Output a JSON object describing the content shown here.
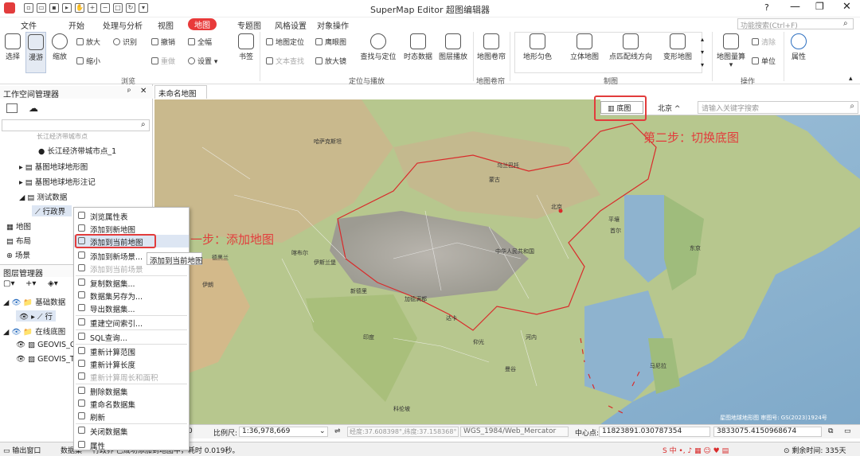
{
  "app": {
    "title": "SuperMap Editor 超图编辑器",
    "search_placeholder": "功能搜索(Ctrl+F)"
  },
  "menu": {
    "tabs": [
      "文件",
      "开始",
      "处理与分析",
      "视图",
      "地图",
      "专题图",
      "风格设置",
      "对象操作"
    ],
    "active": "地图"
  },
  "ribbon": {
    "select": "选择",
    "pan": "漫游",
    "zoom": "缩放",
    "zoom_in": "放大",
    "identify": "识别",
    "zoom_out": "缩小",
    "undo": "撤销",
    "full": "全幅",
    "redo": "重做",
    "settings": "设置",
    "bookmark": "书签",
    "browse_group": "浏览",
    "map_locate": "地图定位",
    "eagle": "鹰眼图",
    "text_find": "文本查找",
    "magnifier": "放大镜",
    "find_locate": "查找与定位",
    "dynamic_data": "时态数据",
    "layer_play": "图层播放",
    "locate_group": "定位与播放",
    "map_roller": "地图卷帘",
    "roller_group": "地图卷帘",
    "terrain_color": "地形匀色",
    "stereo": "立体地图",
    "point_direction": "点匹配线方向",
    "deform": "变形地图",
    "draw_group": "制图",
    "measure": "地图量算",
    "clear": "清除",
    "unit": "单位",
    "ops_group": "操作",
    "properties": "属性"
  },
  "workspace": {
    "title": "工作空间管理器",
    "items": [
      "长江经济带城市点",
      "长江经济带城市点_1",
      "基图地球地形图",
      "基图地球地形注记",
      "测试数据",
      "行政界",
      "地图",
      "布局",
      "场景"
    ]
  },
  "layers": {
    "title": "图层管理器",
    "items": [
      "基础数据",
      "行",
      "在线底图",
      "GEOVIS_C",
      "GEOVIS_T"
    ]
  },
  "context_menu": {
    "items": [
      {
        "label": "浏览属性表",
        "disabled": false
      },
      {
        "label": "添加到新地图",
        "disabled": false
      },
      {
        "label": "添加到当前地图",
        "disabled": false
      },
      {
        "label": "添加到新场景...",
        "disabled": false
      },
      {
        "label": "添加到当前场景",
        "disabled": true
      },
      {
        "label": "复制数据集...",
        "disabled": false
      },
      {
        "label": "数据集另存为...",
        "disabled": false
      },
      {
        "label": "导出数据集...",
        "disabled": false
      },
      {
        "label": "重建空间索引...",
        "disabled": false
      },
      {
        "label": "SQL查询...",
        "disabled": false
      },
      {
        "label": "重新计算范围",
        "disabled": false
      },
      {
        "label": "重新计算长度",
        "disabled": false
      },
      {
        "label": "重新计算周长和面积",
        "disabled": true
      },
      {
        "label": "删除数据集",
        "disabled": false
      },
      {
        "label": "重命名数据集",
        "disabled": false
      },
      {
        "label": "刷新",
        "disabled": false
      },
      {
        "label": "关闭数据集",
        "disabled": false
      },
      {
        "label": "属性",
        "disabled": false
      }
    ],
    "tooltip": "添加到当前地图"
  },
  "map": {
    "tab": "未命名地图",
    "basemap_button": "底图",
    "city": "北京",
    "search_placeholder": "请输入关键字搜索",
    "copyright": "星图地球地形图 审图号: GS(2023)1924号",
    "labels": [
      "北京",
      "乌兰巴托",
      "首尔",
      "东京",
      "平壤",
      "新德里",
      "伊斯兰堡",
      "喀布尔",
      "德黑兰",
      "加德满都",
      "达卡",
      "曼谷",
      "河内",
      "马尼拉",
      "仰光",
      "科伦坡",
      "中华人民共和国",
      "蒙古",
      "印度",
      "哈萨克斯坦",
      "伊朗"
    ]
  },
  "annotations": {
    "step1": "第一步：添加地图",
    "step2": "第二步：切换底图"
  },
  "status": {
    "scale_label": "比例尺:",
    "scale_value": "1:36,978,669",
    "coords": "经度:37.608398°,纬度:37.158368°",
    "crs": "WGS_1984/Web_Mercator",
    "center_label": "中心点:",
    "center_x": "11823891.030787354",
    "center_y": "3833075.4150968674",
    "zero": "0"
  },
  "bottom": {
    "output": "输出窗口",
    "msg_prefix": "数据集",
    "msg": "行政界 已成功添加到地图中，耗时 0.019秒。",
    "days": "剩余时间: 335天"
  }
}
